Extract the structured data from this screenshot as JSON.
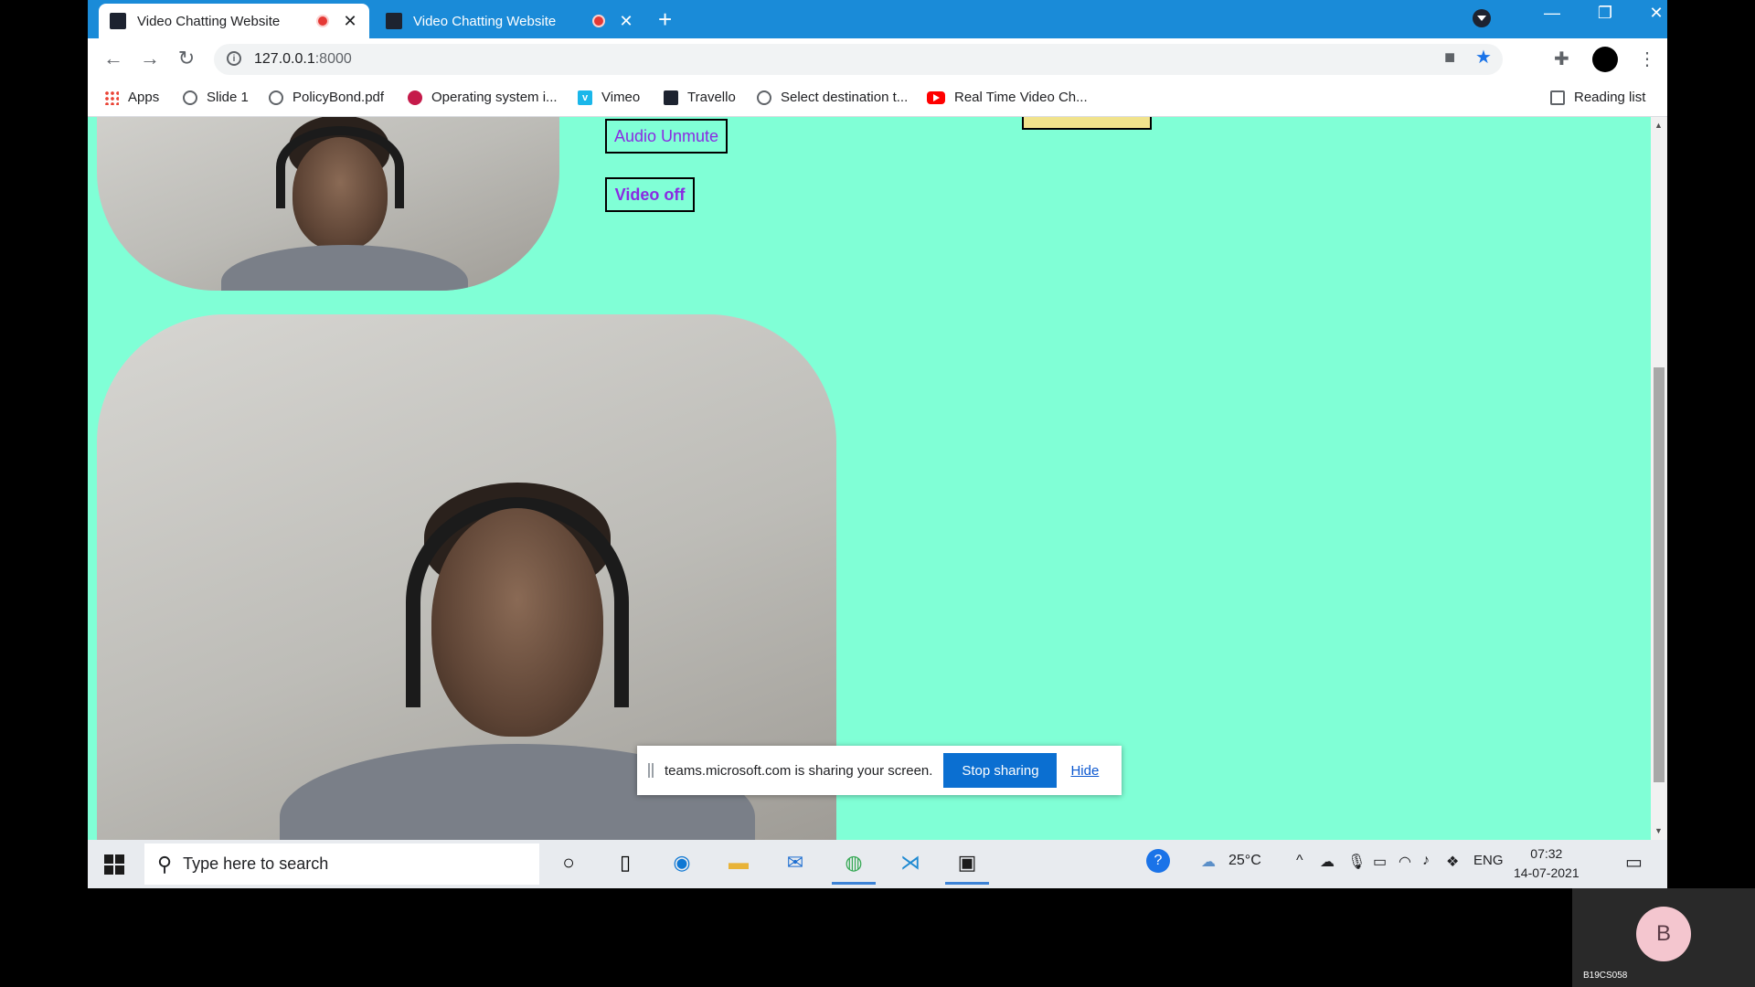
{
  "browser": {
    "tabs": [
      {
        "title": "Video Chatting Website",
        "recording": true,
        "active": true
      },
      {
        "title": "Video Chatting Website",
        "recording": true,
        "active": false
      }
    ],
    "new_tab_label": "+",
    "url_host": "127.0.0.1",
    "url_port": ":8000",
    "bookmarks": [
      {
        "label": "Apps",
        "icon": "apps-grid-icon"
      },
      {
        "label": "Slide 1",
        "icon": "globe-icon"
      },
      {
        "label": "PolicyBond.pdf",
        "icon": "globe-icon"
      },
      {
        "label": "Operating system i...",
        "icon": "raspberry-pi-icon"
      },
      {
        "label": "Vimeo",
        "icon": "vimeo-icon"
      },
      {
        "label": "Travello",
        "icon": "site-favicon-icon"
      },
      {
        "label": "Select destination t...",
        "icon": "globe-icon"
      },
      {
        "label": "Real Time Video Ch...",
        "icon": "youtube-icon"
      }
    ],
    "reading_list_label": "Reading list"
  },
  "page": {
    "background_color": "#80ffd6",
    "audio_button_label": "Audio Unmute",
    "video_button_label": "Video off",
    "button_text_color": "#8a2be2"
  },
  "share_bar": {
    "message": "teams.microsoft.com is sharing your screen.",
    "stop_label": "Stop sharing",
    "hide_label": "Hide"
  },
  "taskbar": {
    "search_placeholder": "Type here to search",
    "temperature": "25°C",
    "language": "ENG",
    "time": "07:32",
    "date": "14-07-2021"
  },
  "teams_tile": {
    "initial": "B",
    "name": "B19CS058"
  }
}
